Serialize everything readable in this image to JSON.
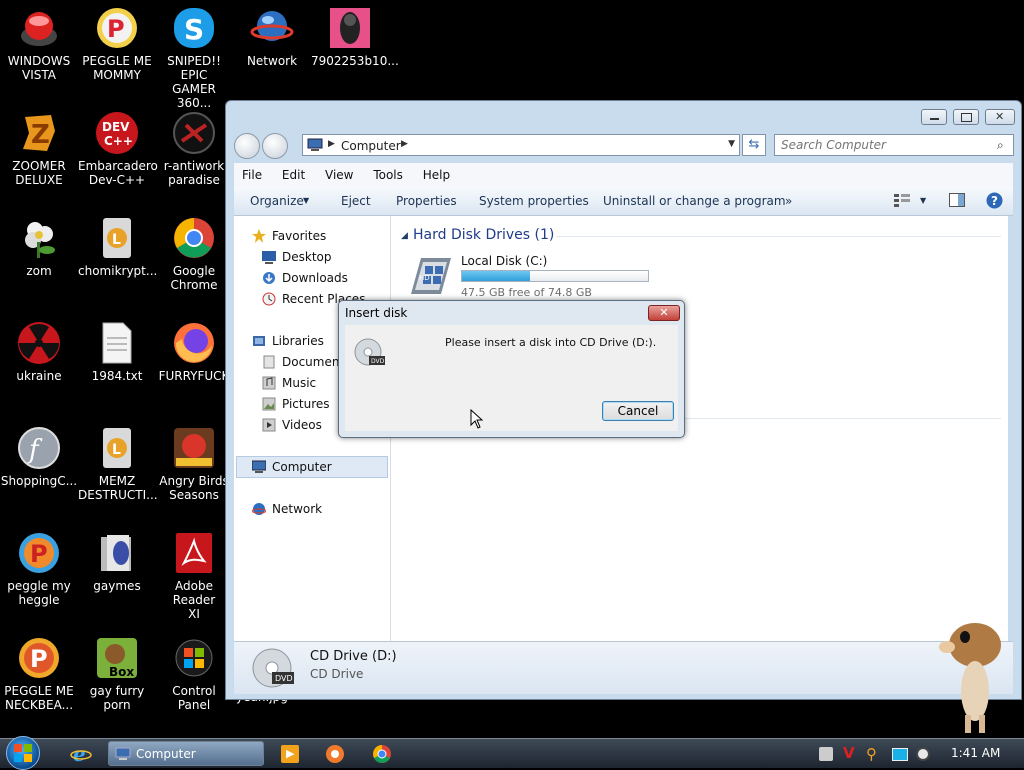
{
  "desktop": {
    "icons": [
      {
        "label": "WINDOWS\nVISTA"
      },
      {
        "label": "PEGGLE ME\nMOMMY"
      },
      {
        "label": "SNIPED!! EPIC\nGAMER 360..."
      },
      {
        "label": "Network"
      },
      {
        "label": "7902253b10..."
      },
      {
        "label": "ZOOMER\nDELUXE"
      },
      {
        "label": "Embarcadero\nDev-C++"
      },
      {
        "label": "r-antiwork\nparadise"
      },
      {
        "label": "zom"
      },
      {
        "label": "chomikrypt..."
      },
      {
        "label": "Google\nChrome"
      },
      {
        "label": "ukraine"
      },
      {
        "label": "1984.txt"
      },
      {
        "label": "FURRYFUCK"
      },
      {
        "label": "ShoppingC..."
      },
      {
        "label": "MEMZ\nDESTRUCTI..."
      },
      {
        "label": "Angry Birds\nSeasons"
      },
      {
        "label": "peggle my\nheggle"
      },
      {
        "label": "gaymes"
      },
      {
        "label": "Adobe Reader\nXI"
      },
      {
        "label": "PEGGLE ME\nNECKBEA..."
      },
      {
        "label": "gay furry\nporn"
      },
      {
        "label": "Control Panel"
      }
    ],
    "overlap_text": "yeah.jpg"
  },
  "explorer": {
    "address": "Computer",
    "search_placeholder": "Search Computer",
    "menu": [
      "File",
      "Edit",
      "View",
      "Tools",
      "Help"
    ],
    "toolbar": [
      "Organize",
      "Eject",
      "Properties",
      "System properties",
      "Uninstall or change a program",
      "»"
    ],
    "nav": {
      "favorites": "Favorites",
      "desktop": "Desktop",
      "downloads": "Downloads",
      "recent": "Recent Places",
      "libraries": "Libraries",
      "documents": "Documents",
      "music": "Music",
      "pictures": "Pictures",
      "videos": "Videos",
      "computer": "Computer",
      "network": "Network"
    },
    "main": {
      "group_title": "Hard Disk Drives (1)",
      "drive_name": "Local Disk (C:)",
      "drive_free": "47.5 GB free of 74.8 GB",
      "drive_used_fraction": 0.365
    },
    "details": {
      "name": "CD Drive (D:)",
      "type": "CD Drive"
    }
  },
  "dialog": {
    "title": "Insert disk",
    "message": "Please insert a disk into CD Drive (D:).",
    "cancel": "Cancel",
    "close_glyph": "✕"
  },
  "taskbar": {
    "active_window": "Computer",
    "clock": "1:41 AM"
  },
  "colors": {
    "accent": "#1f5fa8",
    "drive_bar": "#2f9fd8",
    "taskbar": "#2a3440"
  }
}
